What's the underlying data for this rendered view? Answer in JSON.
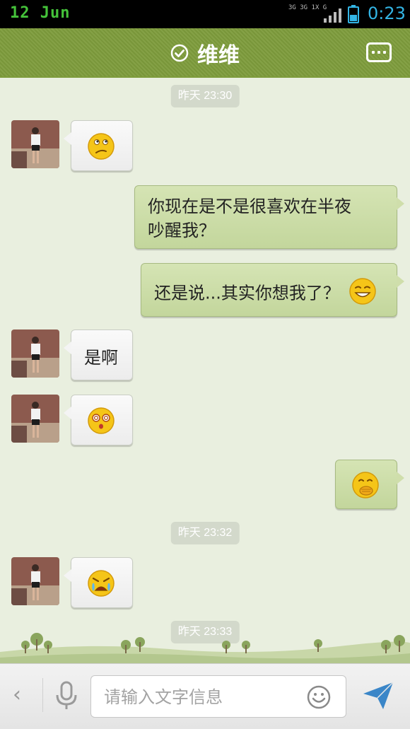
{
  "status_bar": {
    "date": "12 Jun",
    "network": [
      "3G",
      "3G",
      "1X",
      "G"
    ],
    "time": "0:23"
  },
  "header": {
    "title": "维维",
    "verified_icon": "check-circle-icon",
    "more_icon": "more-icon"
  },
  "messages": [
    {
      "type": "timestamp",
      "text": "昨天 23:30"
    },
    {
      "type": "incoming",
      "emoji": "confused-face"
    },
    {
      "type": "outgoing",
      "lines": [
        "你现在是不是很喜欢在半夜",
        "吵醒我？"
      ]
    },
    {
      "type": "outgoing",
      "text": "还是说...其实你想我了？",
      "emoji": "grinning-face"
    },
    {
      "type": "incoming",
      "text": "是啊"
    },
    {
      "type": "incoming",
      "emoji": "dizzy-face"
    },
    {
      "type": "outgoing",
      "emoji": "hand-over-mouth-face"
    },
    {
      "type": "timestamp",
      "text": "昨天 23:32"
    },
    {
      "type": "incoming",
      "emoji": "crying-face"
    },
    {
      "type": "timestamp",
      "text": "昨天 23:33"
    }
  ],
  "input_bar": {
    "placeholder": "请输入文字信息",
    "back_icon": "chevron-left-icon",
    "mic_icon": "microphone-icon",
    "emoji_icon": "smiley-icon",
    "send_icon": "send-icon"
  },
  "colors": {
    "header": "#7e9c3c",
    "chat_background": "#e9efdf",
    "outgoing_bubble": "#c9daa4",
    "incoming_bubble": "#f4f4f4",
    "time_accent": "#33b5e5",
    "date_accent": "#45c23a"
  }
}
